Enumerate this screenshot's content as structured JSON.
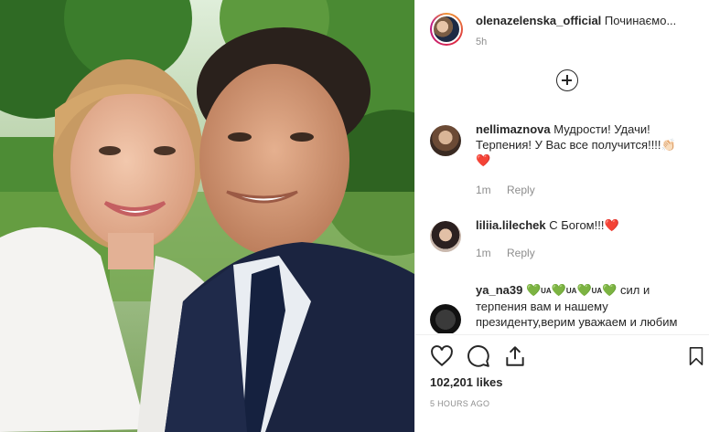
{
  "post": {
    "username": "olenazelenska_official",
    "caption": "Починаємо...",
    "caption_time": "5h",
    "likes": "102,201 likes",
    "posted": "5 HOURS AGO"
  },
  "load_more_icon": "plus-circle-icon",
  "comments": [
    {
      "username": "nellimaznova",
      "text": "Мудрости! Удачи! Терпения! У Вас все получится!!!!👏🏻",
      "emoji_line": "❤️",
      "time": "1m",
      "reply": "Reply"
    },
    {
      "username": "liliia.lilechek",
      "text": "С Богом!!!",
      "emoji": "❤️",
      "time": "1m",
      "reply": "Reply"
    },
    {
      "username": "ya_na39",
      "flag1": "UA",
      "flag2": "UA",
      "flag3": "UA",
      "heart": "💚",
      "text": "сил и терпения вам и нашему президенту,верим уважаем и любим"
    }
  ],
  "actions": {
    "like": "heart-icon",
    "comment": "comment-icon",
    "share": "share-icon",
    "save": "bookmark-icon"
  },
  "colors": {
    "heart_red": "#ed1c24",
    "heart_green": "#27b42a",
    "meta_gray": "#8e8e8e"
  }
}
